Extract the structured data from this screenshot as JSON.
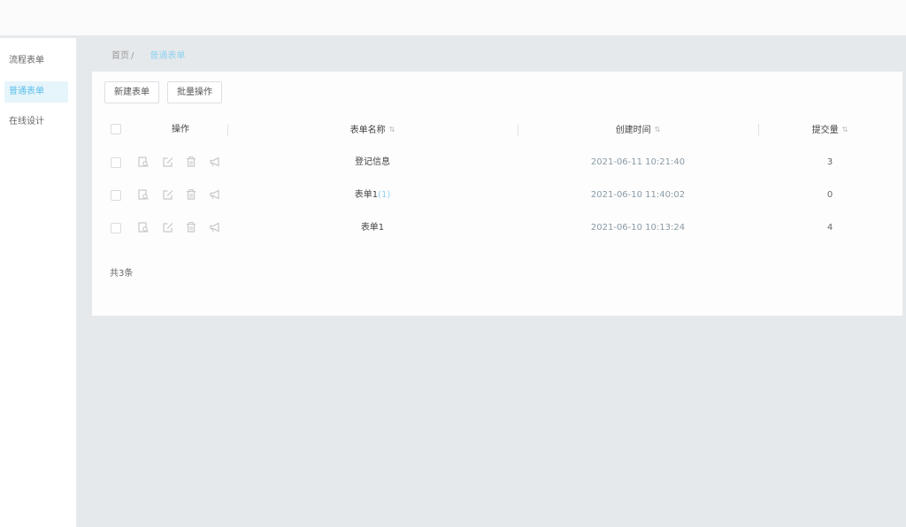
{
  "sidebar": {
    "items": [
      {
        "label": "流程表单",
        "active": false
      },
      {
        "label": "普通表单",
        "active": true
      },
      {
        "label": "在线设计",
        "active": false
      }
    ]
  },
  "breadcrumb": {
    "parent": "首页",
    "separator": "/",
    "current": "普通表单"
  },
  "toolbar": {
    "add_label": "新建表单",
    "batch_label": "批量操作"
  },
  "table": {
    "columns": {
      "ops": "操作",
      "name": "表单名称",
      "time": "创建时间",
      "count": "提交量"
    },
    "rows": [
      {
        "name": "登记信息",
        "name_suffix": "",
        "time": "2021-06-11 10:21:40",
        "count": "3"
      },
      {
        "name": "表单1",
        "name_suffix": "(1)",
        "time": "2021-06-10 11:40:02",
        "count": "0"
      },
      {
        "name": "表单1",
        "name_suffix": "",
        "time": "2021-06-10 10:13:24",
        "count": "4"
      }
    ]
  },
  "footer": {
    "total_text": "共3条"
  },
  "colors": {
    "accent": "#5ac0ec",
    "sidebar_active_bg": "#e6f4fb",
    "page_bg": "#e6e9ec"
  }
}
